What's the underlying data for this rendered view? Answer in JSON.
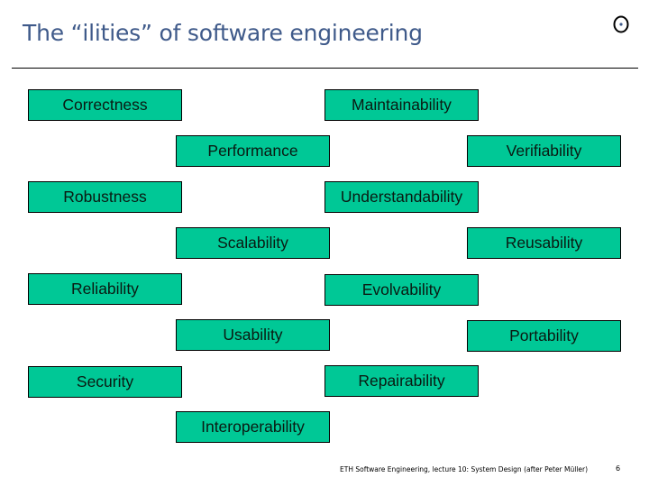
{
  "slide": {
    "title": "The “ilities” of software engineering",
    "logo_icon": "circled-dot-logo-icon",
    "footer_text": "ETH Software Engineering, lecture 10: System Design (after Peter Müller)",
    "page_number": "6"
  },
  "colors": {
    "title": "#3f5a8a",
    "box_fill": "#00c896",
    "box_border": "#000000"
  },
  "qualities": [
    {
      "label": "Correctness"
    },
    {
      "label": "Maintainability"
    },
    {
      "label": "Performance"
    },
    {
      "label": "Verifiability"
    },
    {
      "label": "Robustness"
    },
    {
      "label": "Understandability"
    },
    {
      "label": "Scalability"
    },
    {
      "label": "Reusability"
    },
    {
      "label": "Reliability"
    },
    {
      "label": "Evolvability"
    },
    {
      "label": "Usability"
    },
    {
      "label": "Portability"
    },
    {
      "label": "Security"
    },
    {
      "label": "Repairability"
    },
    {
      "label": "Interoperability"
    }
  ]
}
